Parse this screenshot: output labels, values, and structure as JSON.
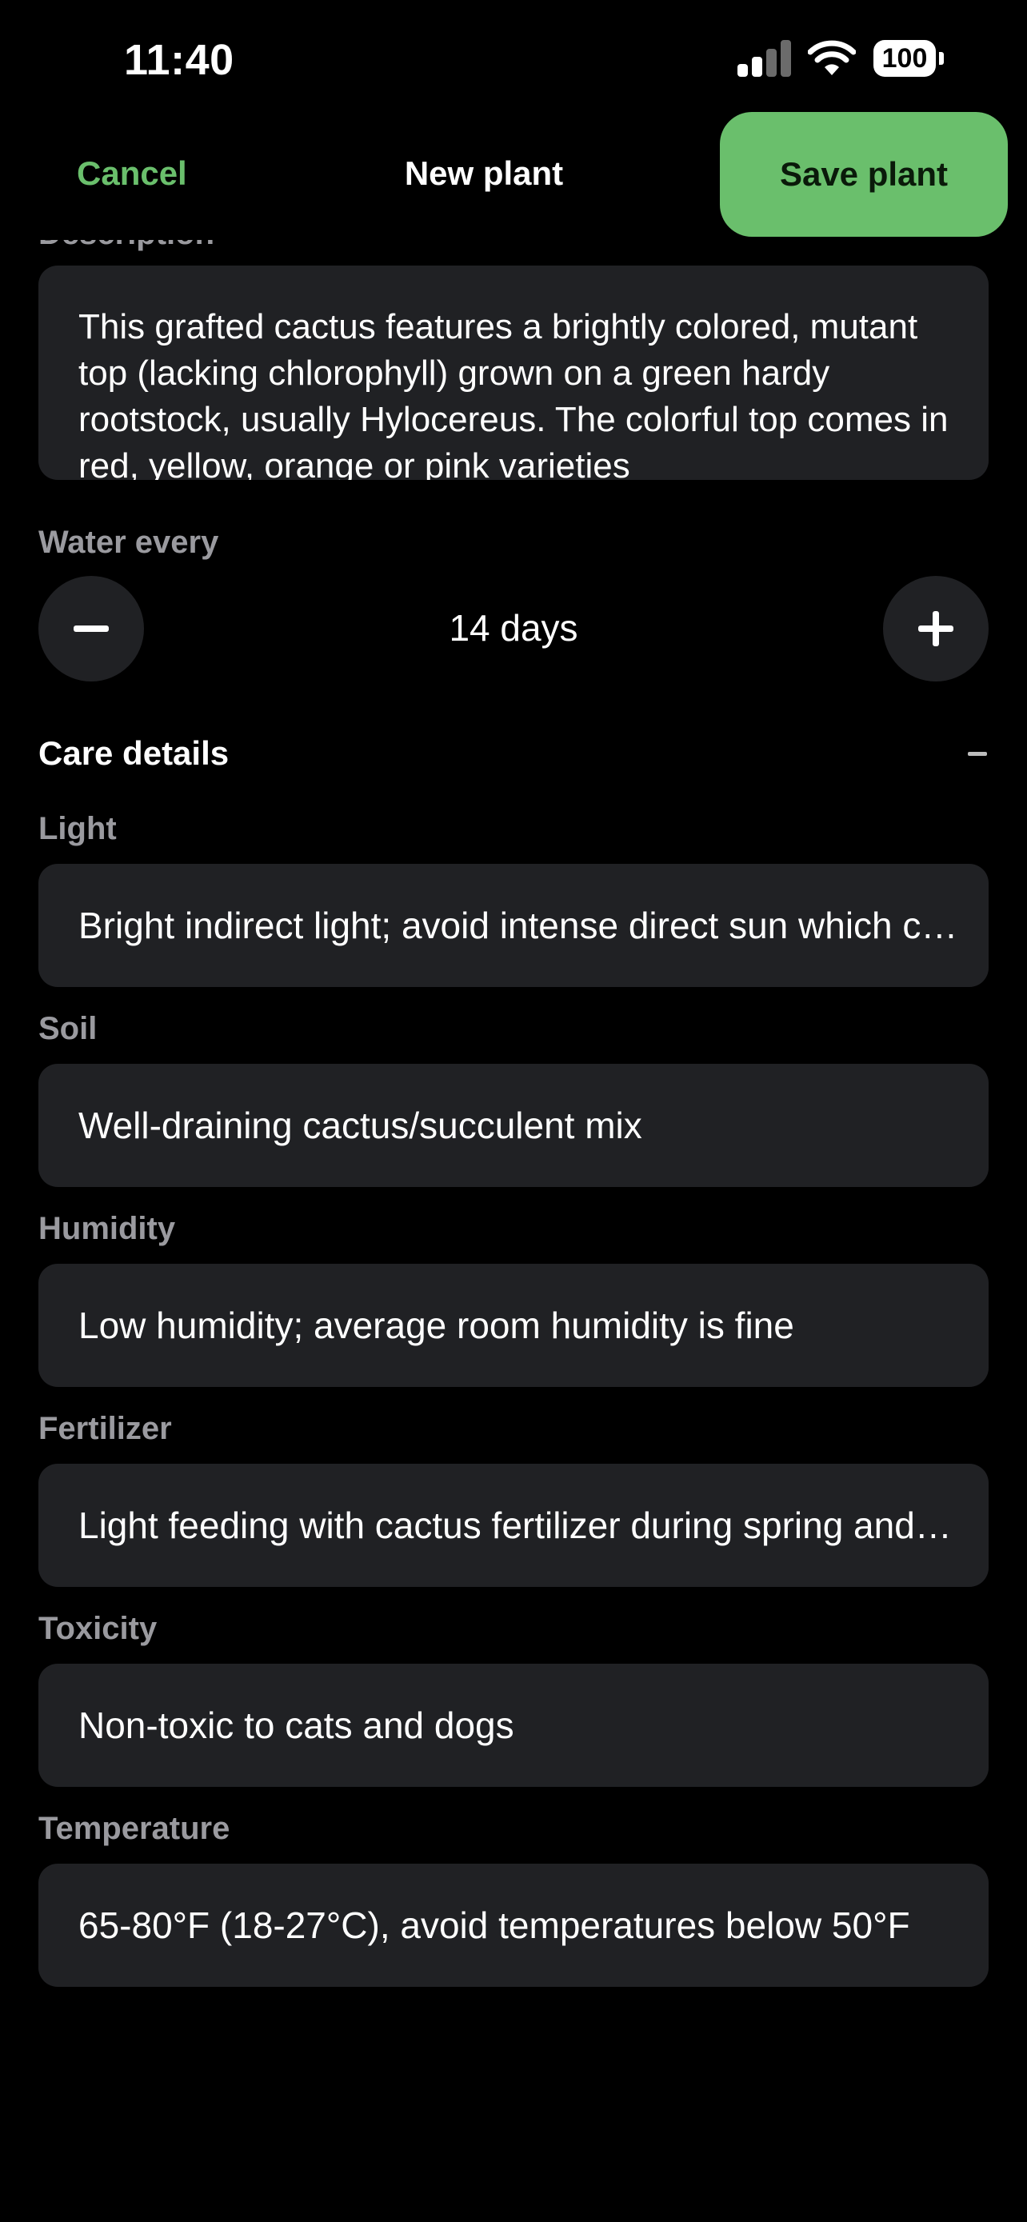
{
  "status": {
    "time": "11:40",
    "battery": "100"
  },
  "nav": {
    "cancel": "Cancel",
    "title": "New plant",
    "save": "Save plant"
  },
  "description": {
    "label": "Description",
    "text": "This grafted cactus features a brightly colored, mutant top (lacking chlorophyll) grown on a green hardy rootstock, usually Hylocereus. The colorful top comes in red, yellow, orange or pink varieties"
  },
  "water": {
    "label": "Water every",
    "value": "14 days"
  },
  "care": {
    "title": "Care details",
    "fields": [
      {
        "label": "Light",
        "value": "Bright indirect light; avoid intense direct sun which can scorch the colorful top"
      },
      {
        "label": "Soil",
        "value": "Well-draining cactus/succulent mix"
      },
      {
        "label": "Humidity",
        "value": "Low humidity; average room humidity is fine"
      },
      {
        "label": "Fertilizer",
        "value": "Light feeding with cactus fertilizer during spring and summer"
      },
      {
        "label": "Toxicity",
        "value": "Non-toxic to cats and dogs"
      },
      {
        "label": "Temperature",
        "value": "65-80°F (18-27°C), avoid temperatures below 50°F"
      }
    ]
  },
  "colors": {
    "accent": "#6abf6c",
    "field_bg": "#202124",
    "label": "#9a9a9f",
    "background": "#000000"
  },
  "icons": {
    "minus": "minus-icon",
    "plus": "plus-icon",
    "collapse": "minus-small-icon"
  }
}
